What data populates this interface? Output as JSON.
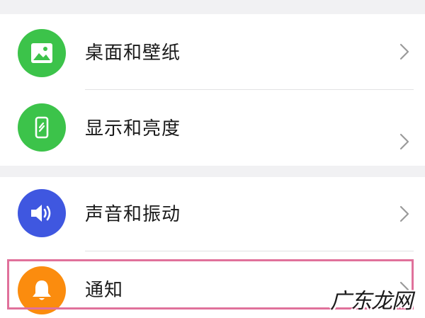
{
  "settings": {
    "items": [
      {
        "label": "桌面和壁纸",
        "icon": "image-icon",
        "color": "#3cc34a"
      },
      {
        "label": "显示和亮度",
        "icon": "phone-display-icon",
        "color": "#3cc34a"
      },
      {
        "label": "声音和振动",
        "icon": "speaker-icon",
        "color": "#3f57e0"
      },
      {
        "label": "通知",
        "icon": "bell-icon",
        "color": "#fb8c0e"
      }
    ]
  },
  "watermark": "广东龙网",
  "colors": {
    "background": "#f1f1f3",
    "card": "#ffffff",
    "highlight": "#e0719b",
    "chevron": "#9a9a9a"
  }
}
